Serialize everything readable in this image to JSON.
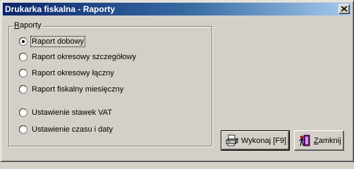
{
  "window": {
    "title": "Drukarka fiskalna - Raporty"
  },
  "group": {
    "label": "Raporty",
    "options": [
      {
        "label": "Raport dobowy",
        "checked": true
      },
      {
        "label": "Raport okresowy szczegółowy",
        "checked": false
      },
      {
        "label": "Raport okresowy łączny",
        "checked": false
      },
      {
        "label": "Raport fiskalny miesięczny",
        "checked": false
      },
      {
        "label": "Ustawienie stawek VAT",
        "checked": false
      },
      {
        "label": "Ustawienie czasu i daty",
        "checked": false
      }
    ]
  },
  "buttons": {
    "execute": {
      "label": "Wykonaj [F9]",
      "icon": "printer-icon"
    },
    "close": {
      "label": "Zamknij",
      "icon": "exit-door-icon"
    }
  },
  "colors": {
    "title_start": "#0a246a",
    "title_end": "#a6caf0",
    "face": "#d4d0c8"
  }
}
